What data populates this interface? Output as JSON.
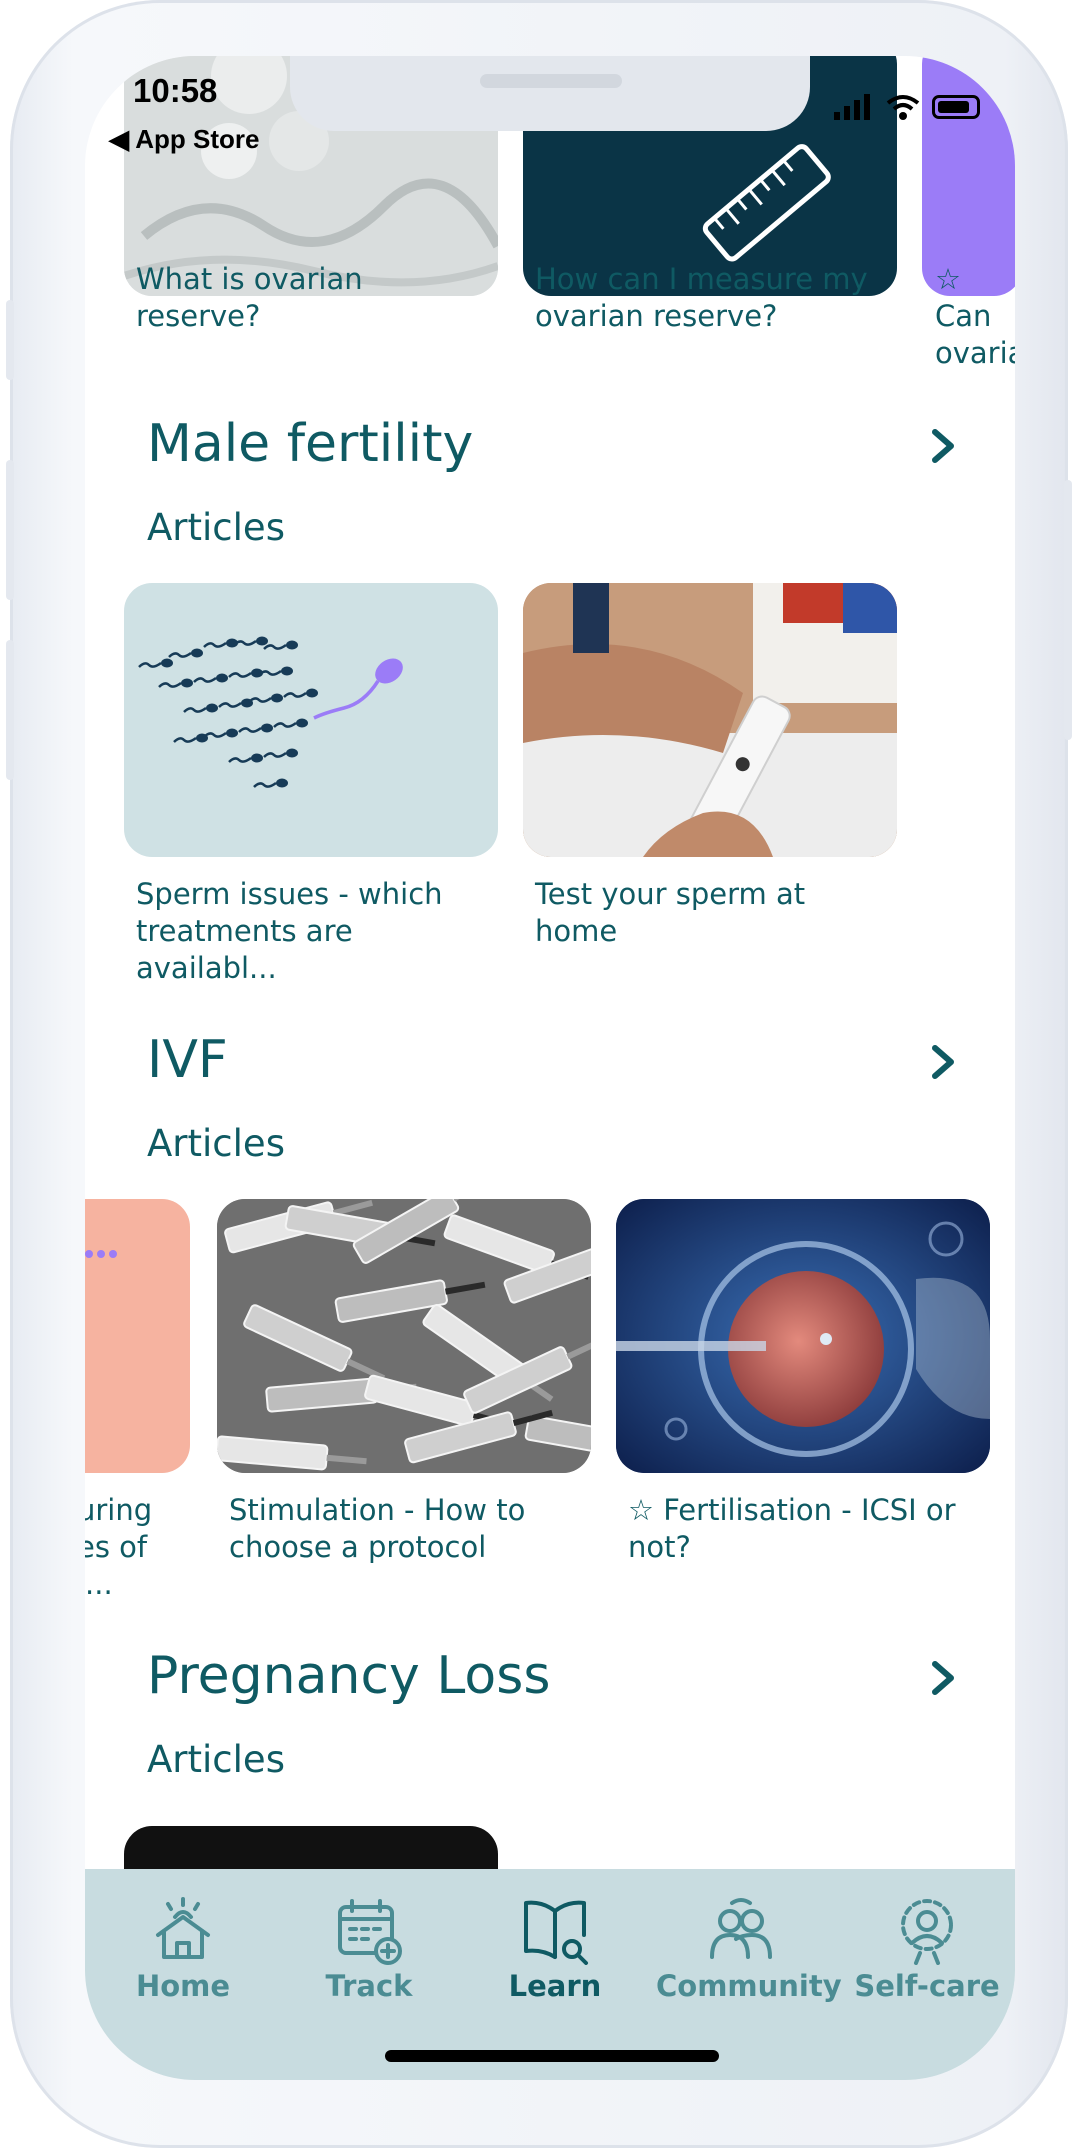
{
  "status_bar": {
    "time": "10:58",
    "back_label": "◀ App Store"
  },
  "top_row": {
    "cards": [
      {
        "title": "What is ovarian reserve?"
      },
      {
        "title": "How can I measure my ovarian reserve?"
      },
      {
        "title": "☆ Can ovaria"
      }
    ]
  },
  "sections": [
    {
      "title": "Male fertility",
      "subtitle": "Articles",
      "cards": [
        {
          "title": "Sperm issues - which treatments are availabl..."
        },
        {
          "title": "Test your sperm at home"
        }
      ]
    },
    {
      "title": "IVF",
      "subtitle": "Articles",
      "cards": [
        {
          "title": "uring es of l..."
        },
        {
          "title": "Stimulation - How to choose a protocol"
        },
        {
          "title": "☆ Fertilisation - ICSI or not?"
        }
      ]
    },
    {
      "title": "Pregnancy Loss",
      "subtitle": "Articles"
    }
  ],
  "tabbar": {
    "tabs": [
      {
        "label": "Home",
        "icon": "home-icon"
      },
      {
        "label": "Track",
        "icon": "calendar-add-icon"
      },
      {
        "label": "Learn",
        "icon": "book-search-icon",
        "active": true
      },
      {
        "label": "Community",
        "icon": "community-icon"
      },
      {
        "label": "Self-care",
        "icon": "self-care-icon"
      }
    ]
  },
  "colors": {
    "accent": "#0f5a63",
    "tab_inactive": "#4b8c93",
    "tabbar_bg": "#c8dce0",
    "card_light": "#cfe1e4",
    "card_dark": "#0a3446",
    "card_purple": "#9b7cf7",
    "card_salmon": "#f6b3a0"
  }
}
